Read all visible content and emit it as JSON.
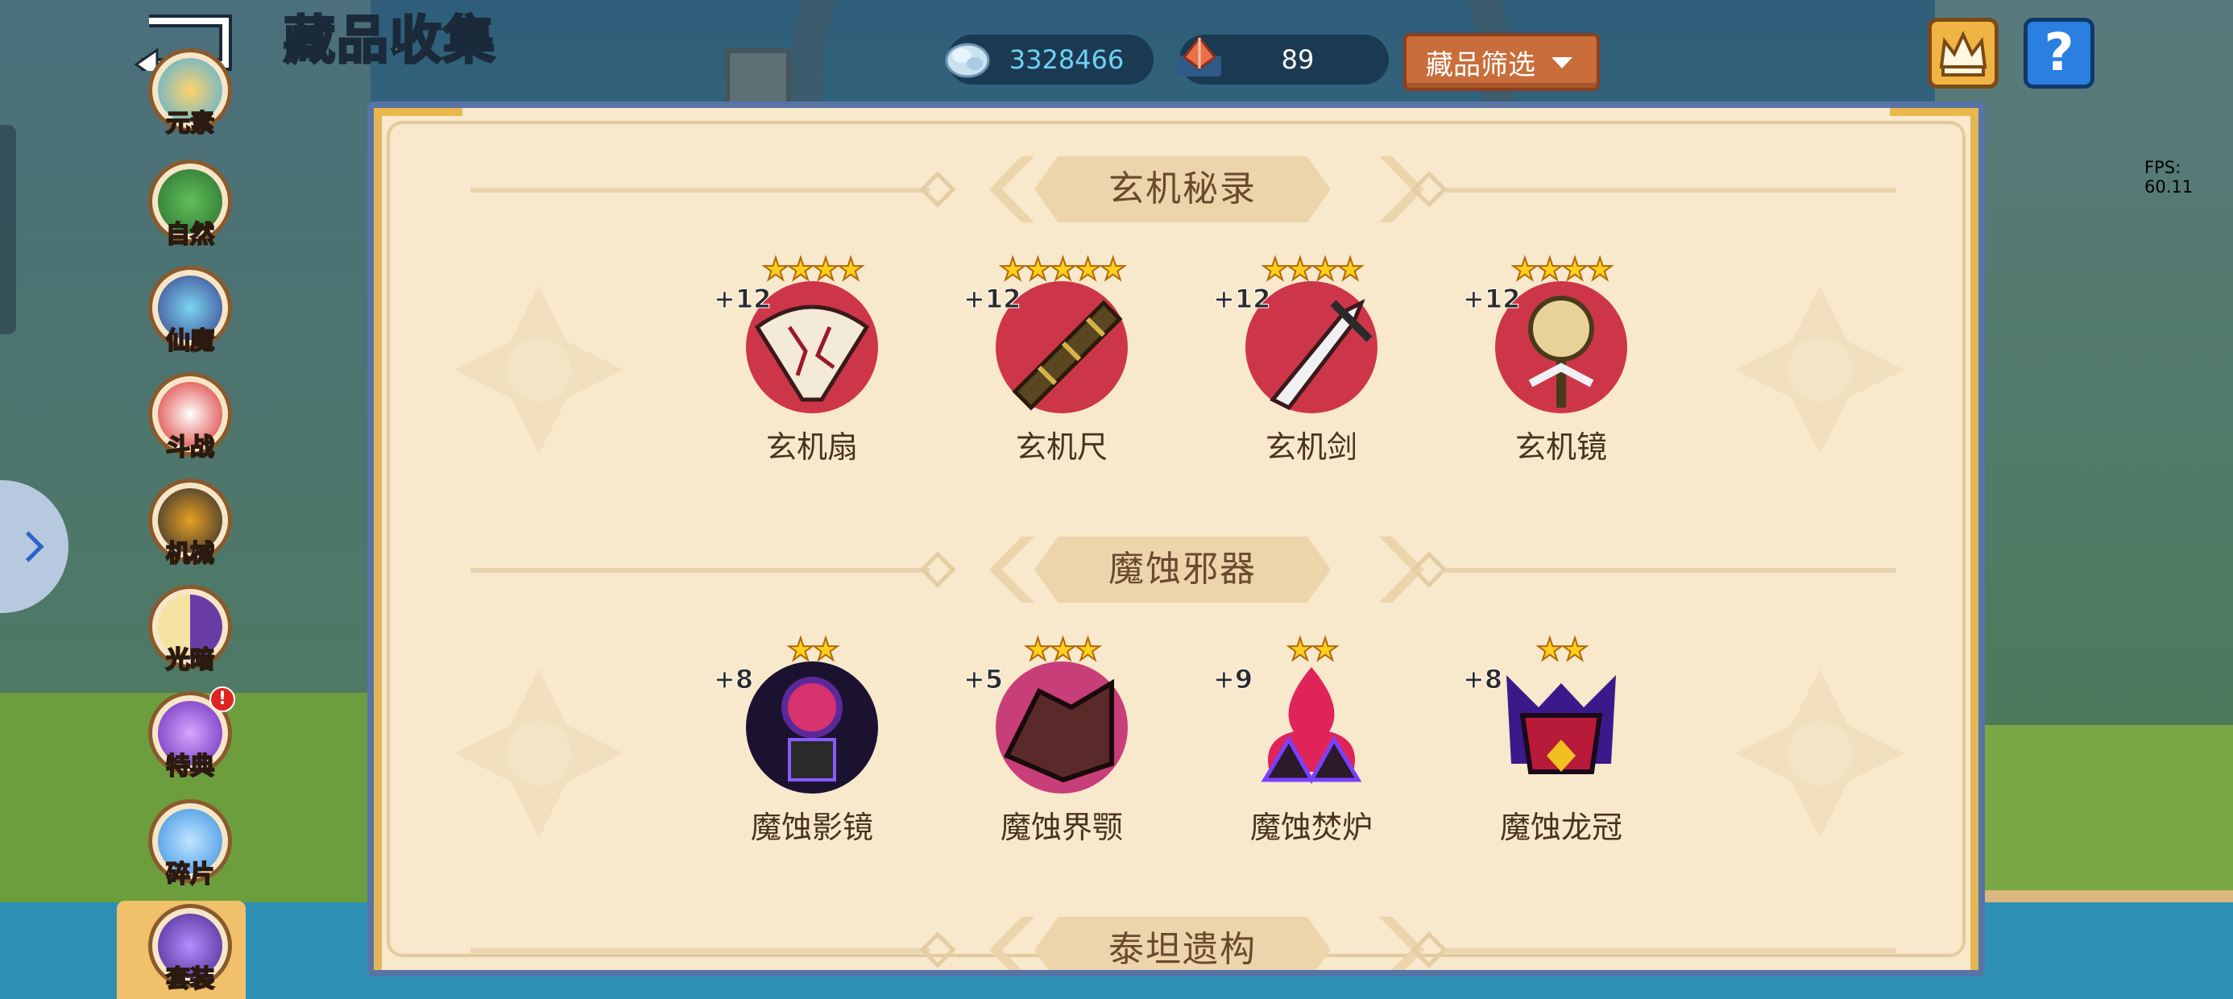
{
  "header": {
    "title": "藏品收集",
    "crystal_value": "3328466",
    "gem_value": "89",
    "filter_label": "藏品筛选",
    "help_label": "?"
  },
  "debug": {
    "fps": "FPS: 60.11"
  },
  "nav": {
    "items": [
      {
        "label": "元素"
      },
      {
        "label": "自然"
      },
      {
        "label": "仙魔"
      },
      {
        "label": "斗战"
      },
      {
        "label": "机械"
      },
      {
        "label": "光暗"
      },
      {
        "label": "特典",
        "badge": "!"
      },
      {
        "label": "碎片"
      },
      {
        "label": "套装"
      }
    ],
    "selected": "套装"
  },
  "sections": [
    {
      "title": "玄机秘录",
      "items": [
        {
          "name": "玄机扇",
          "level": "+12",
          "stars": 4
        },
        {
          "name": "玄机尺",
          "level": "+12",
          "stars": 5
        },
        {
          "name": "玄机剑",
          "level": "+12",
          "stars": 4
        },
        {
          "name": "玄机镜",
          "level": "+12",
          "stars": 4
        }
      ]
    },
    {
      "title": "魔蚀邪器",
      "items": [
        {
          "name": "魔蚀影镜",
          "level": "+8",
          "stars": 2
        },
        {
          "name": "魔蚀界颚",
          "level": "+5",
          "stars": 3
        },
        {
          "name": "魔蚀焚炉",
          "level": "+9",
          "stars": 2
        },
        {
          "name": "魔蚀龙冠",
          "level": "+8",
          "stars": 2
        }
      ]
    },
    {
      "title": "泰坦遗构",
      "items": []
    }
  ],
  "colors": {
    "panel_bg": "#f8e8cc",
    "panel_border": "#5873a6",
    "filter_button": "#c96d3a",
    "star": "#ffcf1e",
    "crystal_text": "#6fd3f2"
  }
}
